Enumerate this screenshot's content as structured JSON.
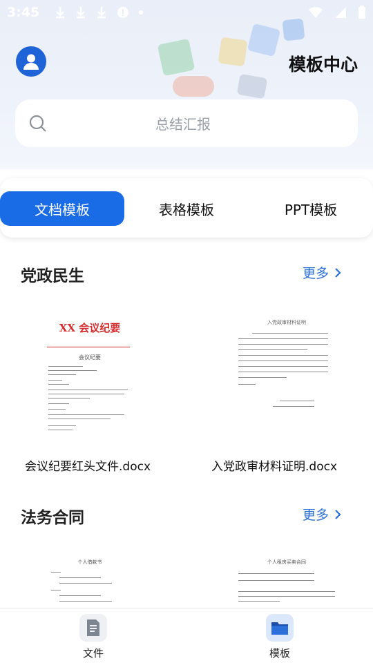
{
  "status_bar": {
    "time": "3:45"
  },
  "header": {
    "title": "模板中心"
  },
  "search": {
    "placeholder": "总结汇报"
  },
  "tabs": [
    {
      "label": "文档模板",
      "active": true
    },
    {
      "label": "表格模板",
      "active": false
    },
    {
      "label": "PPT模板",
      "active": false
    }
  ],
  "sections": [
    {
      "title": "党政民生",
      "more_label": "更多",
      "documents": [
        {
          "name": "会议纪要红头文件.docx",
          "thumb_heading": "XX 会议纪要",
          "thumb_subheading": "会议纪要"
        },
        {
          "name": "入党政审材料证明.docx",
          "thumb_heading": "入党政审材料证明"
        }
      ]
    },
    {
      "title": "法务合同",
      "more_label": "更多",
      "documents": [
        {
          "thumb_heading": "个人借款书"
        },
        {
          "thumb_heading": "个人租房买卖合同"
        }
      ]
    }
  ],
  "bottom_nav": [
    {
      "label": "文件",
      "icon": "document-icon",
      "active": false
    },
    {
      "label": "模板",
      "icon": "folder-icon",
      "active": true
    }
  ],
  "colors": {
    "accent": "#1a6be6",
    "avatar": "#1e64d6",
    "red_heading": "#d62b2b"
  }
}
